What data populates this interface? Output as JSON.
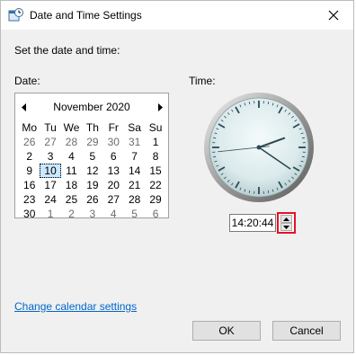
{
  "window": {
    "title": "Date and Time Settings",
    "icon": "clock-calendar-icon"
  },
  "instruction": "Set the date and time:",
  "date_label": "Date:",
  "time_label": "Time:",
  "calendar": {
    "month_year": "November 2020",
    "prev_icon": "triangle-left-icon",
    "next_icon": "triangle-right-icon",
    "days_of_week": [
      "Mo",
      "Tu",
      "We",
      "Th",
      "Fr",
      "Sa",
      "Su"
    ],
    "weeks": [
      [
        {
          "d": "26",
          "m": true
        },
        {
          "d": "27",
          "m": true
        },
        {
          "d": "28",
          "m": true
        },
        {
          "d": "29",
          "m": true
        },
        {
          "d": "30",
          "m": true
        },
        {
          "d": "31",
          "m": true
        },
        {
          "d": "1"
        }
      ],
      [
        {
          "d": "2"
        },
        {
          "d": "3"
        },
        {
          "d": "4"
        },
        {
          "d": "5"
        },
        {
          "d": "6"
        },
        {
          "d": "7"
        },
        {
          "d": "8"
        }
      ],
      [
        {
          "d": "9"
        },
        {
          "d": "10",
          "sel": true
        },
        {
          "d": "11"
        },
        {
          "d": "12"
        },
        {
          "d": "13"
        },
        {
          "d": "14"
        },
        {
          "d": "15"
        }
      ],
      [
        {
          "d": "16"
        },
        {
          "d": "17"
        },
        {
          "d": "18"
        },
        {
          "d": "19"
        },
        {
          "d": "20"
        },
        {
          "d": "21"
        },
        {
          "d": "22"
        }
      ],
      [
        {
          "d": "23"
        },
        {
          "d": "24"
        },
        {
          "d": "25"
        },
        {
          "d": "26"
        },
        {
          "d": "27"
        },
        {
          "d": "28"
        },
        {
          "d": "29"
        }
      ],
      [
        {
          "d": "30"
        },
        {
          "d": "1",
          "m": true
        },
        {
          "d": "2",
          "m": true
        },
        {
          "d": "3",
          "m": true
        },
        {
          "d": "4",
          "m": true
        },
        {
          "d": "5",
          "m": true
        },
        {
          "d": "6",
          "m": true
        }
      ]
    ]
  },
  "clock": {
    "hour": 14,
    "minute": 20,
    "second": 44
  },
  "time_field": {
    "value": "14:20:44"
  },
  "spinner": {
    "up_icon": "spin-up-icon",
    "down_icon": "spin-down-icon",
    "highlight_color": "#e81123"
  },
  "link": "Change calendar settings",
  "buttons": {
    "ok": "OK",
    "cancel": "Cancel"
  },
  "colors": {
    "link": "#0066cc",
    "selected_day": "#cce8ff"
  }
}
